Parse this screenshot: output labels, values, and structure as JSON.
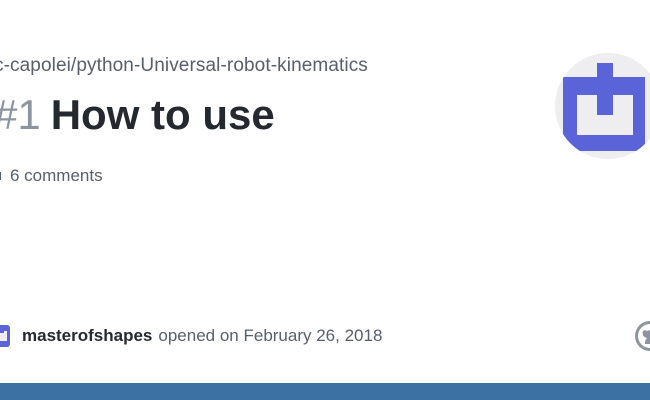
{
  "issue": {
    "repo_path": "c-capolei/python-Universal-robot-kinematics",
    "number": "#1",
    "title": "How to use",
    "comments": "6 comments"
  },
  "author": {
    "name": "masterofshapes",
    "opened_text": "opened on February 26, 2018"
  },
  "icons": {
    "repo_avatar": "brand-logo-icon",
    "comment": "comment-icon",
    "author_avatar": "user-avatar-icon",
    "github": "github-icon"
  },
  "colors": {
    "accent": "#5a63d8",
    "footer": "#3b72a3",
    "title": "#24292f",
    "muted": "#57606a"
  }
}
